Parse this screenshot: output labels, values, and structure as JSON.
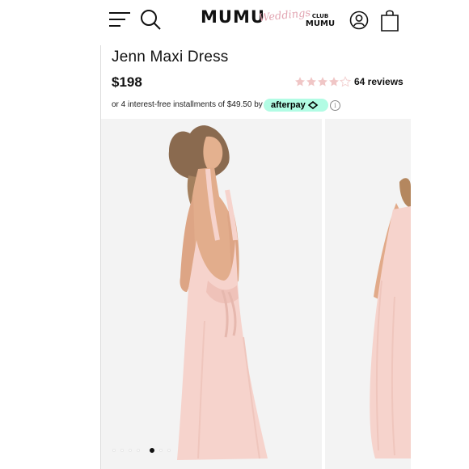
{
  "header": {
    "logo_main": "MUMU",
    "logo_script": "Weddings",
    "logo_club": "CLUB",
    "logo_club_mumu": "MUMU",
    "icons": [
      "menu-icon",
      "search-icon",
      "account-icon",
      "bag-icon"
    ]
  },
  "product": {
    "title": "Jenn Maxi Dress",
    "price": "$198",
    "rating": 4,
    "rating_max": 5,
    "reviews_label": "64 reviews"
  },
  "afterpay": {
    "text": "or 4 interest-free installments of $49.50 by",
    "brand": "afterpay",
    "info_glyph": "i",
    "badge_color": "#b2fce4"
  },
  "gallery": {
    "slide_count": 7,
    "active_index": 4
  },
  "colors": {
    "dress": "#f6d3cc",
    "star_filled": "#f0c6c6",
    "star_empty": "#f2cfcf"
  }
}
